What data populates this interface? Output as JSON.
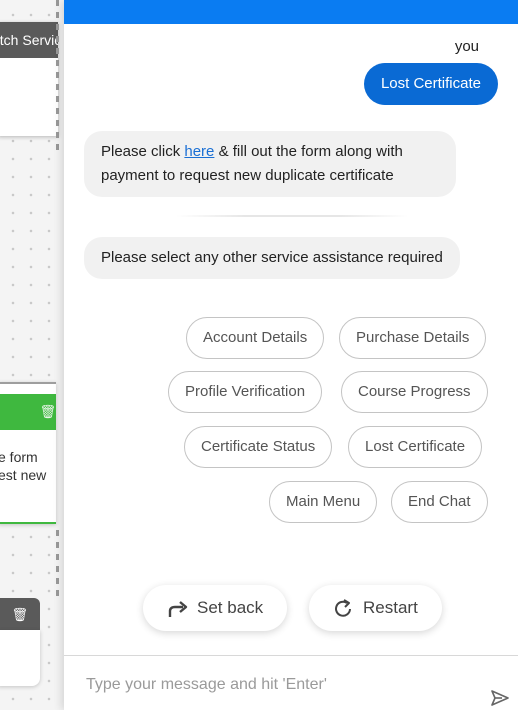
{
  "background": {
    "top_node_title": "atch Servic",
    "middle_node_text": [
      "e form",
      "est new"
    ],
    "trash_icon": "trash-icon"
  },
  "chat": {
    "sender_label": "you",
    "user_message": "Lost Certificate",
    "bot_message_1": {
      "before_link": "Please click ",
      "link_text": "here",
      "after_link": " & fill out the form along with payment to request new duplicate certificate"
    },
    "bot_message_2": "Please select any other service assistance required",
    "options": [
      "Account Details",
      "Purchase Details",
      "Profile Verification",
      "Course Progress",
      "Certificate Status",
      "Lost Certificate",
      "Main Menu",
      "End Chat"
    ],
    "set_back_label": "Set back",
    "restart_label": "Restart",
    "composer_placeholder": "Type your message and hit 'Enter'",
    "colors": {
      "header": "#0a7cf2",
      "user_bubble": "#0a6ad4",
      "link": "#1a6fd4",
      "canvas_node_green": "#3fb83f"
    }
  }
}
